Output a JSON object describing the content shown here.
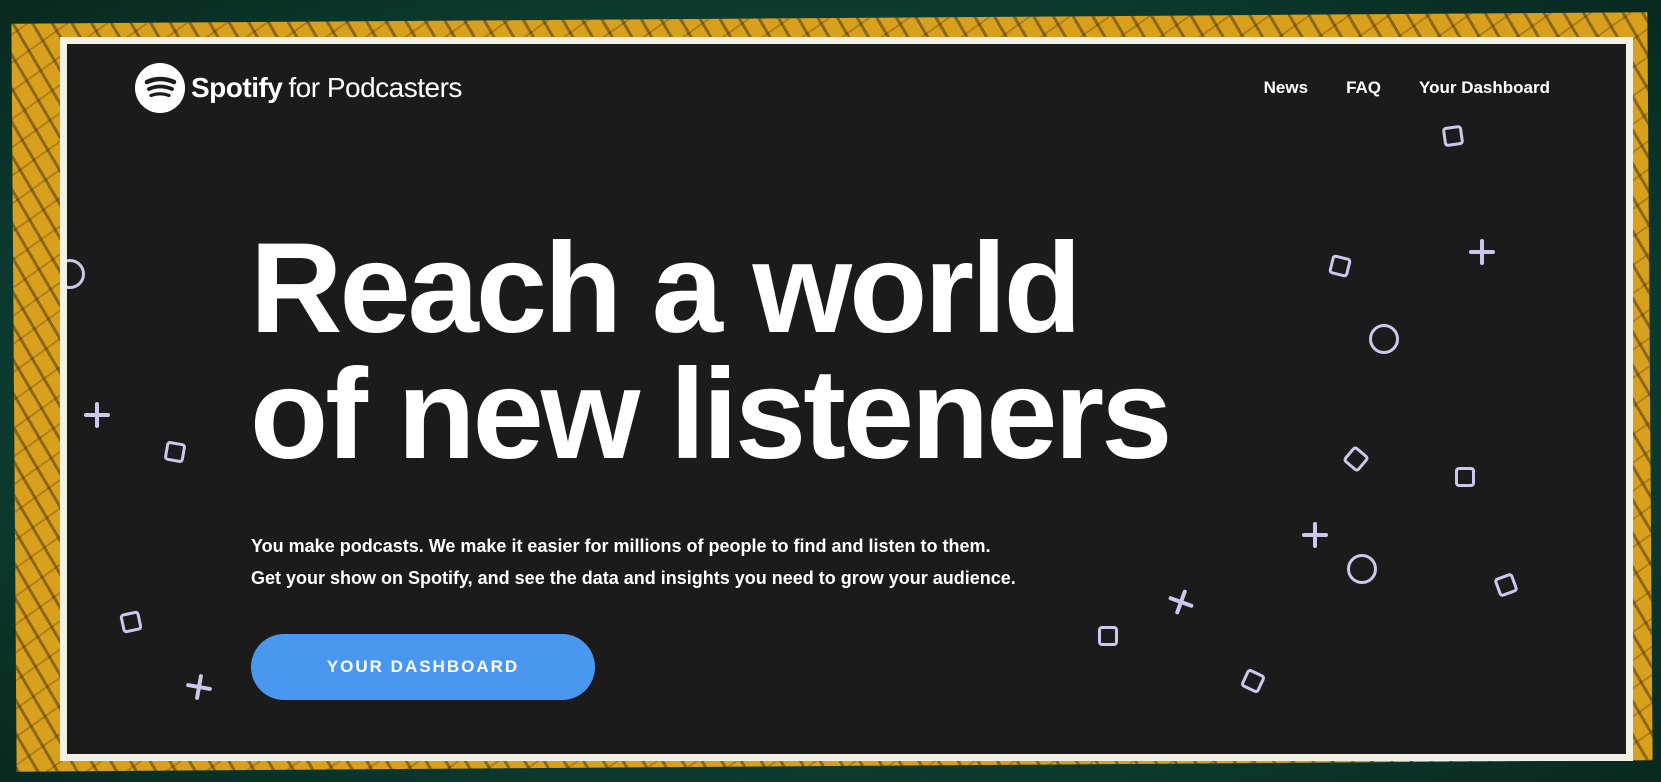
{
  "header": {
    "logo_brand": "Spotify",
    "logo_suffix": "for Podcasters",
    "logo_icon": "spotify-icon",
    "nav": [
      {
        "label": "News"
      },
      {
        "label": "FAQ"
      },
      {
        "label": "Your Dashboard"
      }
    ]
  },
  "hero": {
    "headline_line1": "Reach a world",
    "headline_line2": "of new listeners",
    "subtext_line1": "You make podcasts. We make it easier for millions of people to find and listen to them.",
    "subtext_line2": "Get your show on Spotify, and see the data and insights you need to grow your audience.",
    "cta_label": "YOUR DASHBOARD"
  },
  "colors": {
    "page_background": "#1c1b1b",
    "cta_blue": "#4a97f2",
    "decor_lavender": "#cfc6ec",
    "backdrop_yellow": "#d9a01e",
    "backdrop_green": "#0e3f33"
  },
  "decorations": [
    "square-icon",
    "circle-icon",
    "cross-icon"
  ]
}
